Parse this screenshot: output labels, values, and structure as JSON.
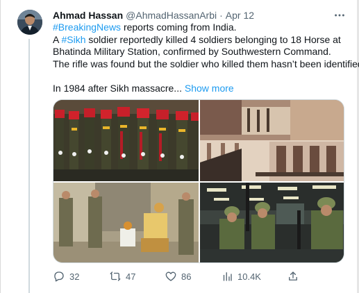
{
  "tweet": {
    "author": {
      "name": "Ahmad Hassan",
      "handle": "@AhmadHassanArbi",
      "separator": "·",
      "date": "Apr 12"
    },
    "text": {
      "line1_tag": "#BreakingNews",
      "line1_rest": " reports coming from India.",
      "line2_pre": "A ",
      "line2_tag": "#Sikh",
      "line2_rest": " soldier reportedly killed 4 soldiers belonging to 18 Horse at",
      "line3": "Bhatinda Military Station, confirmed by Southwestern Command.",
      "line4": "The rifle was found but the soldier who killed them hasn’t been identified.",
      "line5": "In 1984 after Sikh massacre...",
      "show_more": "Show more"
    },
    "media": [
      {
        "description": "soldiers-parade-photo"
      },
      {
        "description": "golden-temple-damage-photo"
      },
      {
        "description": "soldiers-and-detainees-photo"
      },
      {
        "description": "soldiers-holding-rifles-photo"
      }
    ],
    "actions": {
      "replies": "32",
      "retweets": "47",
      "likes": "86",
      "views": "10.4K"
    },
    "icons": {
      "more": "more-icon",
      "reply": "reply-icon",
      "retweet": "retweet-icon",
      "like": "heart-icon",
      "views": "views-icon",
      "share": "share-icon"
    },
    "colors": {
      "link": "#1d9bf0",
      "secondary": "#536471",
      "primary": "#0f1419"
    }
  }
}
